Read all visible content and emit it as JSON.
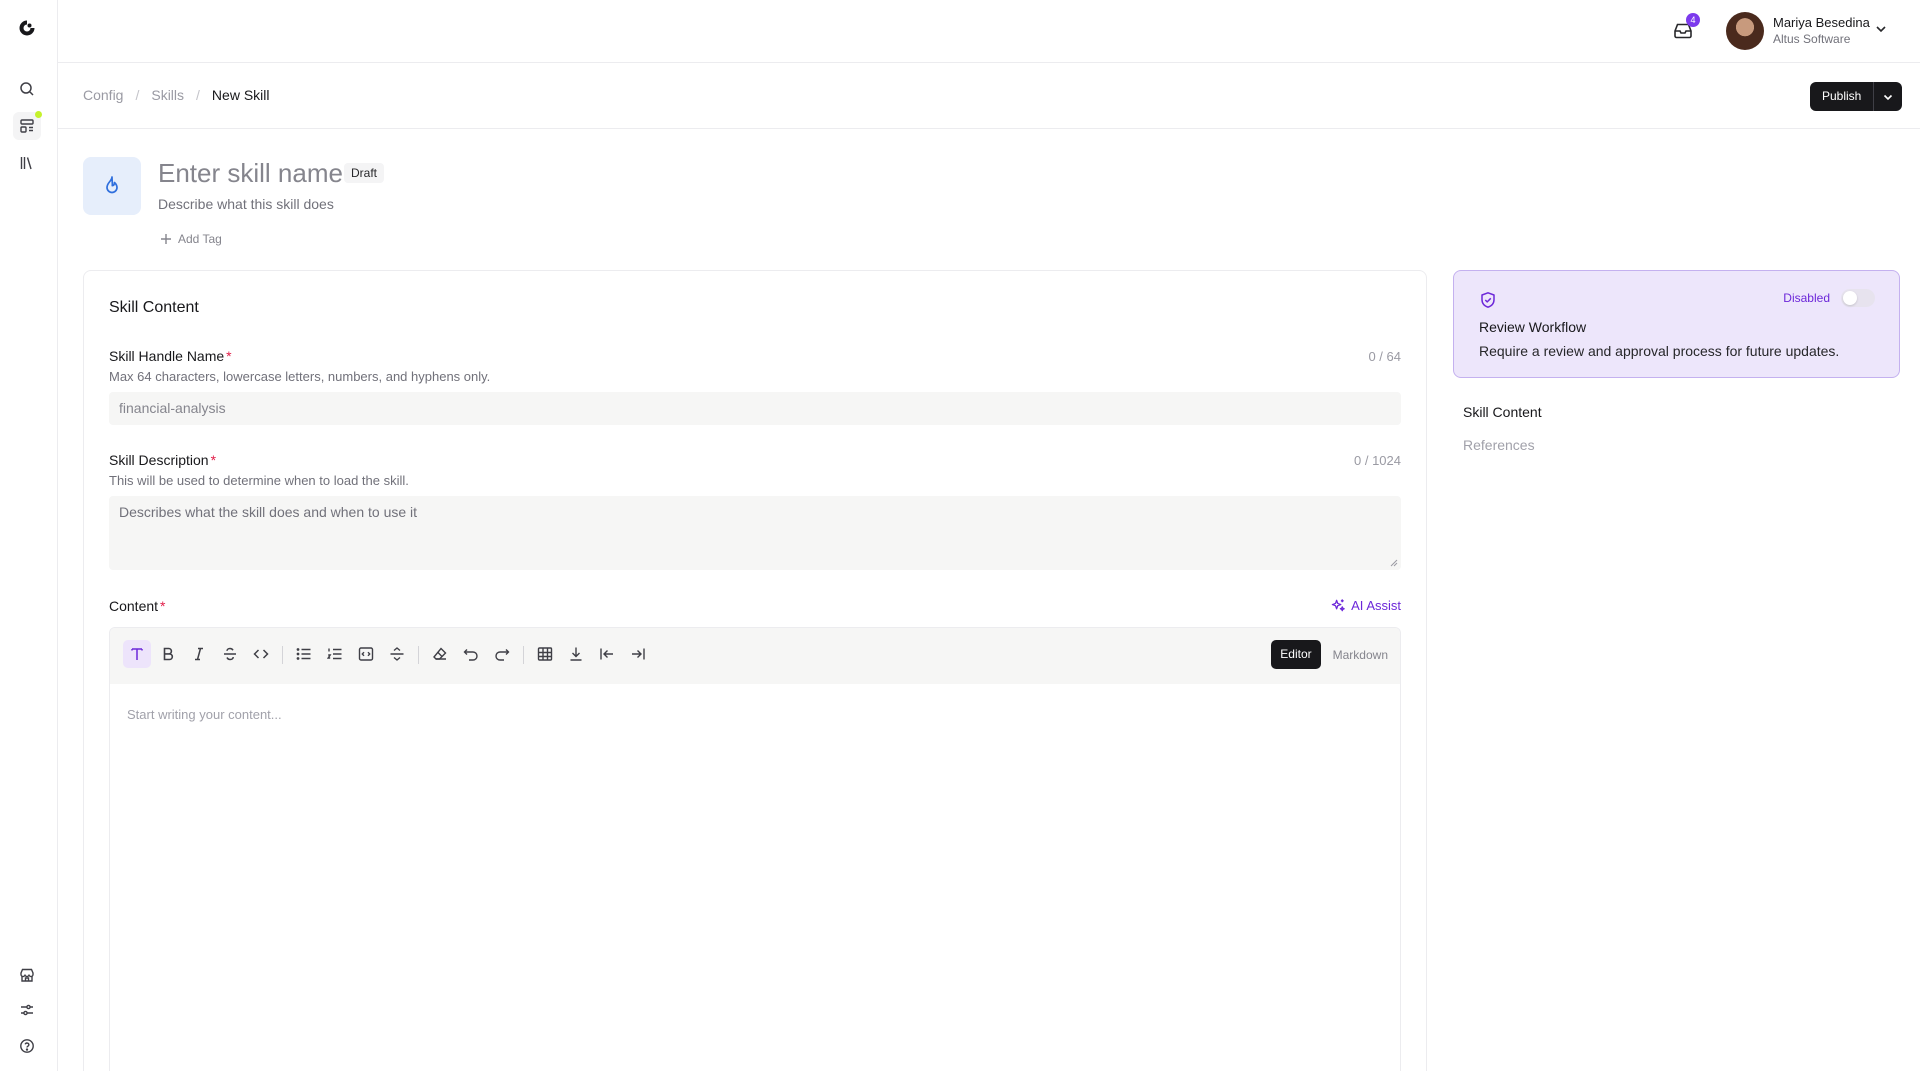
{
  "header": {
    "inbox_count": "4",
    "user": {
      "name": "Mariya Besedina",
      "org": "Altus Software"
    }
  },
  "breadcrumb": {
    "items": [
      "Config",
      "Skills"
    ],
    "current": "New Skill"
  },
  "actions": {
    "publish_label": "Publish"
  },
  "skill": {
    "name_placeholder": "Enter skill name",
    "status_badge": "Draft",
    "description_placeholder": "Describe what this skill does",
    "add_tag_label": "Add Tag"
  },
  "content_card": {
    "title": "Skill Content",
    "handle": {
      "label": "Skill Handle Name",
      "required_mark": "*",
      "counter": "0 / 64",
      "hint": "Max 64 characters, lowercase letters, numbers, and hyphens only.",
      "placeholder": "financial-analysis"
    },
    "description": {
      "label": "Skill Description",
      "required_mark": "*",
      "counter": "0 / 1024",
      "hint": "This will be used to determine when to load the skill.",
      "placeholder": "Describes what the skill does and when to use it"
    },
    "content": {
      "label": "Content",
      "required_mark": "*",
      "ai_assist_label": "AI Assist",
      "mode_editor": "Editor",
      "mode_markdown": "Markdown",
      "placeholder": "Start writing your content..."
    }
  },
  "review_workflow": {
    "status": "Disabled",
    "enabled": false,
    "title": "Review Workflow",
    "description": "Require a review and approval process for future updates."
  },
  "toc": {
    "items": [
      "Skill Content",
      "References"
    ],
    "active_index": 0
  },
  "colors": {
    "accent": "#6d28d9",
    "brand_dark": "#18181b",
    "notify_dot": "#c5f22c",
    "required": "#e11d48"
  }
}
